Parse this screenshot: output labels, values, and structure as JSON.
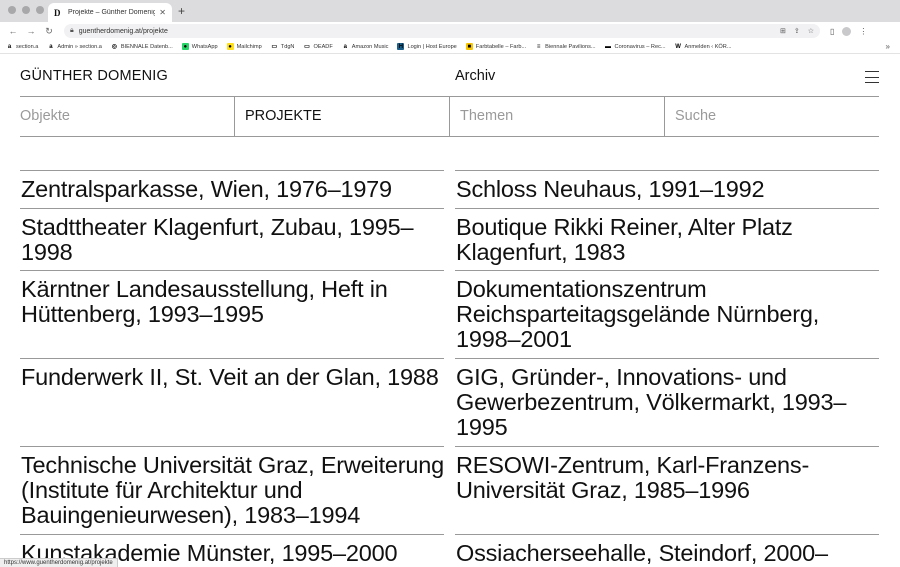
{
  "browser": {
    "tab_title": "Projekte – Günther Domenig",
    "url": "guentherdomenig.at/projekte",
    "bookmarks": [
      {
        "label": "section.a",
        "icon": "a"
      },
      {
        "label": "Admin » section.a",
        "icon": "a"
      },
      {
        "label": "BIENNALE Datenb...",
        "icon": "◎"
      },
      {
        "label": "WhatsApp",
        "icon": "●"
      },
      {
        "label": "Mailchimp",
        "icon": "●"
      },
      {
        "label": "TdgN",
        "icon": "▭"
      },
      {
        "label": "OEADF",
        "icon": "▭"
      },
      {
        "label": "Amazon Music",
        "icon": "a"
      },
      {
        "label": "Login | Host Europe",
        "icon": "H"
      },
      {
        "label": "Farbtabelle – Farb...",
        "icon": "■"
      },
      {
        "label": "Biennale Pavilions...",
        "icon": "≡"
      },
      {
        "label": "Coronavirus – Rec...",
        "icon": "▬"
      },
      {
        "label": "Anmelden ‹ KÖR...",
        "icon": "W"
      }
    ],
    "status_url": "https://www.guentherdomenig.at/projekte"
  },
  "header": {
    "site_title": "GÜNTHER DOMENIG",
    "archive_link": "Archiv"
  },
  "tabs": [
    {
      "label": "Objekte",
      "active": false
    },
    {
      "label": "PROJEKTE",
      "active": true
    },
    {
      "label": "Themen",
      "active": false
    },
    {
      "label": "Suche",
      "active": false
    }
  ],
  "projects": [
    [
      "Zentralsparkasse, Wien, 1976–1979",
      "Schloss Neuhaus, 1991–1992"
    ],
    [
      "Stadttheater Klagenfurt, Zubau, 1995–1998",
      "Boutique Rikki Reiner, Alter Platz Klagenfurt, 1983"
    ],
    [
      "Kärntner Landesausstellung, Heft in Hüttenberg, 1993–1995",
      "Dokumentationszentrum Reichsparteitagsgelände Nürnberg, 1998–2001"
    ],
    [
      "Funderwerk II, St. Veit an der Glan, 1988",
      "GIG, Gründer-, Innovations- und Gewerbezentrum, Völkermarkt, 1993–1995"
    ],
    [
      "Technische Universität Graz, Erweiterung (Institute für Architektur und Bauingenieurwesen), 1983–1994",
      "RESOWI-Zentrum, Karl-Franzens-Universität Graz, 1985–1996"
    ],
    [
      "Kunstakademie Münster, 1995–2000",
      "Ossiacherseehalle, Steindorf, 2000–"
    ]
  ]
}
